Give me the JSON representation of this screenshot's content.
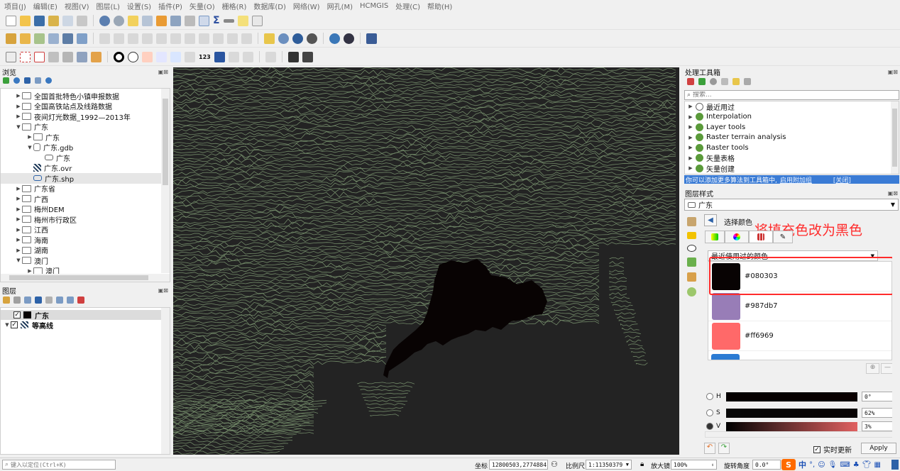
{
  "menu": [
    "项目(J)",
    "编辑(E)",
    "视图(V)",
    "图层(L)",
    "设置(S)",
    "插件(P)",
    "矢量(O)",
    "栅格(R)",
    "数据库(D)",
    "网络(W)",
    "网孔(M)",
    "HCMGIS",
    "处理(C)",
    "帮助(H)"
  ],
  "browser": {
    "title": "浏览",
    "items": [
      {
        "label": "全国首批特色小镇申报数据",
        "level": 1,
        "expanded": false,
        "icon": "folder-icon"
      },
      {
        "label": "全国高铁站点及线路数据",
        "level": 1,
        "expanded": false,
        "icon": "folder-icon"
      },
      {
        "label": "夜间灯光数据_1992—2013年",
        "level": 1,
        "expanded": false,
        "icon": "folder-icon"
      },
      {
        "label": "广东",
        "level": 1,
        "expanded": true,
        "icon": "folder-icon"
      },
      {
        "label": "广东",
        "level": 2,
        "expanded": false,
        "icon": "folder-icon"
      },
      {
        "label": "广东.gdb",
        "level": 2,
        "expanded": true,
        "icon": "database-icon"
      },
      {
        "label": "广东",
        "level": 3,
        "expanded": null,
        "icon": "polygon-layer-icon"
      },
      {
        "label": "广东.ovr",
        "level": 2,
        "expanded": null,
        "icon": "raster-icon"
      },
      {
        "label": "广东.shp",
        "level": 2,
        "expanded": null,
        "icon": "polygon-layer-icon"
      },
      {
        "label": "广东省",
        "level": 1,
        "expanded": false,
        "icon": "folder-icon"
      },
      {
        "label": "广西",
        "level": 1,
        "expanded": false,
        "icon": "folder-icon"
      },
      {
        "label": "梅州DEM",
        "level": 1,
        "expanded": false,
        "icon": "folder-icon"
      },
      {
        "label": "梅州市行政区",
        "level": 1,
        "expanded": false,
        "icon": "folder-icon"
      },
      {
        "label": "江西",
        "level": 1,
        "expanded": false,
        "icon": "folder-icon"
      },
      {
        "label": "海南",
        "level": 1,
        "expanded": false,
        "icon": "folder-icon"
      },
      {
        "label": "湖南",
        "level": 1,
        "expanded": false,
        "icon": "folder-icon"
      },
      {
        "label": "澳门",
        "level": 1,
        "expanded": true,
        "icon": "folder-icon"
      },
      {
        "label": "澳门",
        "level": 2,
        "expanded": false,
        "icon": "folder-icon"
      }
    ]
  },
  "layers": {
    "title": "图层",
    "items": [
      {
        "label": "广东",
        "checked": true,
        "color": "#080303"
      },
      {
        "label": "等高线",
        "checked": true,
        "color": "#1f3a5a"
      }
    ]
  },
  "toolbox": {
    "title": "处理工具箱",
    "search_placeholder": "搜索...",
    "items": [
      "最近用过",
      "Interpolation",
      "Layer tools",
      "Raster terrain analysis",
      "Raster tools",
      "矢量表格",
      "矢量创建"
    ],
    "notice": "你可以添加更多算法到工具箱中,",
    "notice_link": "启用附加组",
    "notice_close": "[关闭]"
  },
  "layer_style": {
    "title": "图层样式",
    "layer_select": "广东",
    "select_color_title": "选择颜色",
    "recent_label": "最近使用过的颜色",
    "annotation": "将填充色改为黑色",
    "recent_colors": [
      {
        "hex": "#080303",
        "color": "#080303"
      },
      {
        "hex": "#987db7",
        "color": "#987db7"
      },
      {
        "hex": "#ff6969",
        "color": "#ff6969"
      }
    ],
    "h_label": "H",
    "h_value": "0°",
    "s_label": "S",
    "s_value": "62%",
    "v_label": "V",
    "v_value": "3%",
    "live_update": "实时更新",
    "apply": "Apply"
  },
  "status": {
    "locate_placeholder": "键入以定位(Ctrl+K)",
    "coord_label": "坐标",
    "coord_value": "12800503,2774884",
    "scale_label": "比例尺",
    "scale_value": "1:11350379",
    "magnifier_label": "放大镜",
    "magnifier_value": "100%",
    "rotation_label": "旋转角度",
    "rotation_value": "0.0°"
  },
  "colors": {
    "accent": "#ff2b2b",
    "map_bg": "#232323",
    "contour": "#7f9a74",
    "fill": "#080303"
  }
}
